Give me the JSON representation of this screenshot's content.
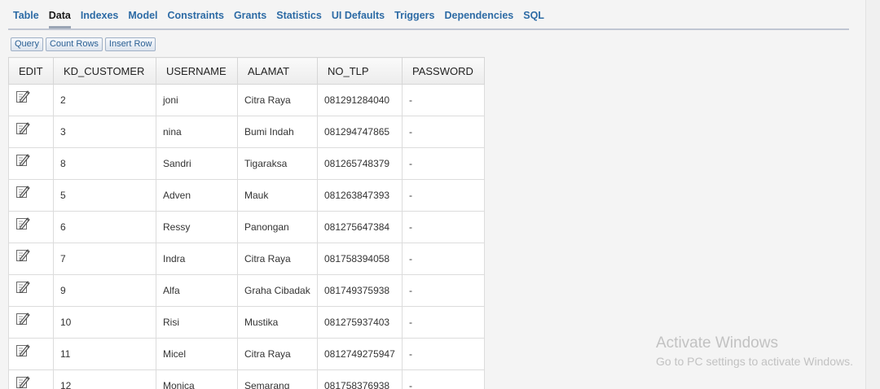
{
  "tabs": [
    {
      "label": "Table",
      "active": false
    },
    {
      "label": "Data",
      "active": true
    },
    {
      "label": "Indexes",
      "active": false
    },
    {
      "label": "Model",
      "active": false
    },
    {
      "label": "Constraints",
      "active": false
    },
    {
      "label": "Grants",
      "active": false
    },
    {
      "label": "Statistics",
      "active": false
    },
    {
      "label": "UI Defaults",
      "active": false
    },
    {
      "label": "Triggers",
      "active": false
    },
    {
      "label": "Dependencies",
      "active": false
    },
    {
      "label": "SQL",
      "active": false
    }
  ],
  "toolbar": {
    "query": "Query",
    "count_rows": "Count Rows",
    "insert_row": "Insert Row"
  },
  "grid": {
    "columns": [
      "EDIT",
      "KD_CUSTOMER",
      "USERNAME",
      "ALAMAT",
      "NO_TLP",
      "PASSWORD"
    ],
    "rows": [
      {
        "kd": "2",
        "username": "joni",
        "alamat": "Citra Raya",
        "no_tlp": "081291284040",
        "password": "-"
      },
      {
        "kd": "3",
        "username": "nina",
        "alamat": "Bumi Indah",
        "no_tlp": "081294747865",
        "password": "-"
      },
      {
        "kd": "8",
        "username": "Sandri",
        "alamat": "Tigaraksa",
        "no_tlp": "081265748379",
        "password": "-"
      },
      {
        "kd": "5",
        "username": "Adven",
        "alamat": "Mauk",
        "no_tlp": "081263847393",
        "password": "-"
      },
      {
        "kd": "6",
        "username": "Ressy",
        "alamat": "Panongan",
        "no_tlp": "081275647384",
        "password": "-"
      },
      {
        "kd": "7",
        "username": "Indra",
        "alamat": "Citra Raya",
        "no_tlp": "081758394058",
        "password": "-"
      },
      {
        "kd": "9",
        "username": "Alfa",
        "alamat": "Graha Cibadak",
        "no_tlp": "081749375938",
        "password": "-"
      },
      {
        "kd": "10",
        "username": "Risi",
        "alamat": "Mustika",
        "no_tlp": "081275937403",
        "password": "-"
      },
      {
        "kd": "11",
        "username": "Micel",
        "alamat": "Citra Raya",
        "no_tlp": "0812749275947",
        "password": "-"
      },
      {
        "kd": "12",
        "username": "Monica",
        "alamat": "Semarang",
        "no_tlp": "081758376938",
        "password": "-"
      }
    ]
  },
  "watermark": {
    "title": "Activate Windows",
    "subtitle": "Go to PC settings to activate Windows."
  },
  "colors": {
    "tab_link": "#2d6ba5",
    "tab_active": "#1a1a1a",
    "accent_line": "#c0c6d2"
  }
}
